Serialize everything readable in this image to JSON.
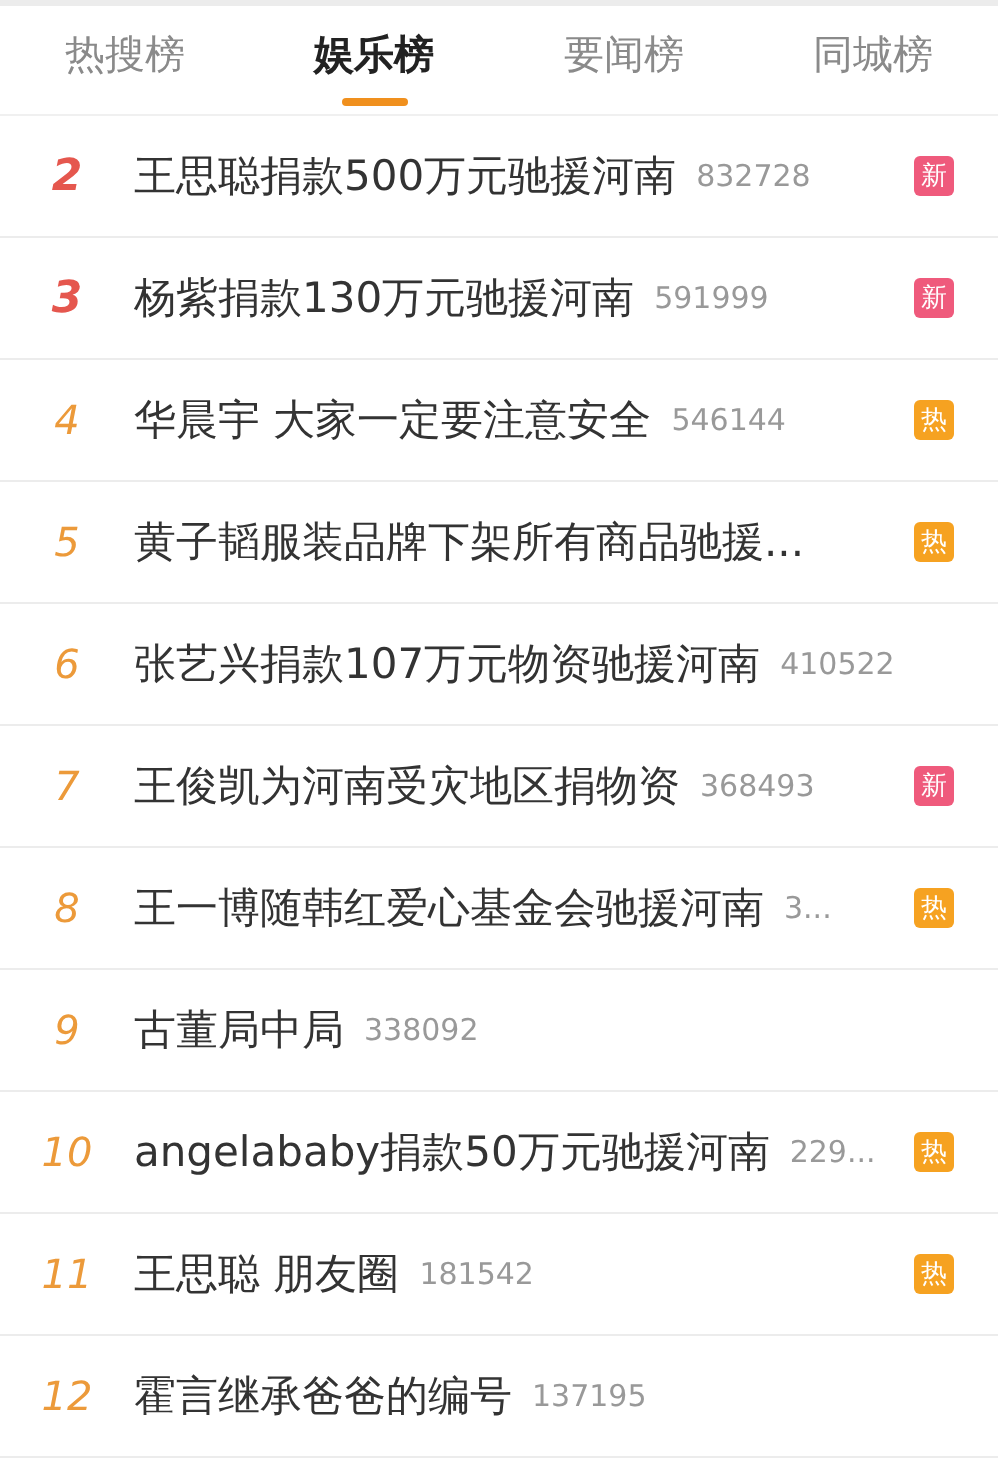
{
  "tabs": [
    {
      "label": "热搜榜",
      "selected": false
    },
    {
      "label": "娱乐榜",
      "selected": true
    },
    {
      "label": "要闻榜",
      "selected": false
    },
    {
      "label": "同城榜",
      "selected": false
    }
  ],
  "items": [
    {
      "rank": "2",
      "top": true,
      "title": "王思聪捐款500万元驰援河南",
      "count": "832728",
      "badge": {
        "kind": "new",
        "label": "新"
      }
    },
    {
      "rank": "3",
      "top": true,
      "title": "杨紫捐款130万元驰援河南",
      "count": "591999",
      "badge": {
        "kind": "new",
        "label": "新"
      }
    },
    {
      "rank": "4",
      "top": false,
      "title": "华晨宇 大家一定要注意安全",
      "count": "546144",
      "badge": {
        "kind": "hot",
        "label": "热"
      }
    },
    {
      "rank": "5",
      "top": false,
      "title": "黄子韬服装品牌下架所有商品驰援...",
      "badge": {
        "kind": "hot",
        "label": "热"
      }
    },
    {
      "rank": "6",
      "top": false,
      "title": "张艺兴捐款107万元物资驰援河南",
      "count": "410522"
    },
    {
      "rank": "7",
      "top": false,
      "title": "王俊凯为河南受灾地区捐物资",
      "count": "368493",
      "badge": {
        "kind": "new",
        "label": "新"
      }
    },
    {
      "rank": "8",
      "top": false,
      "title": "王一博随韩红爱心基金会驰援河南",
      "count": "3...",
      "badge": {
        "kind": "hot",
        "label": "热"
      }
    },
    {
      "rank": "9",
      "top": false,
      "title": "古董局中局",
      "count": "338092"
    },
    {
      "rank": "10",
      "top": false,
      "title": "angelababy捐款50万元驰援河南",
      "count": "229...",
      "badge": {
        "kind": "hot",
        "label": "热"
      }
    },
    {
      "rank": "11",
      "top": false,
      "title": "王思聪 朋友圈",
      "count": "181542",
      "badge": {
        "kind": "hot",
        "label": "热"
      }
    },
    {
      "rank": "12",
      "top": false,
      "title": "霍言继承爸爸的编号",
      "count": "137195"
    }
  ]
}
